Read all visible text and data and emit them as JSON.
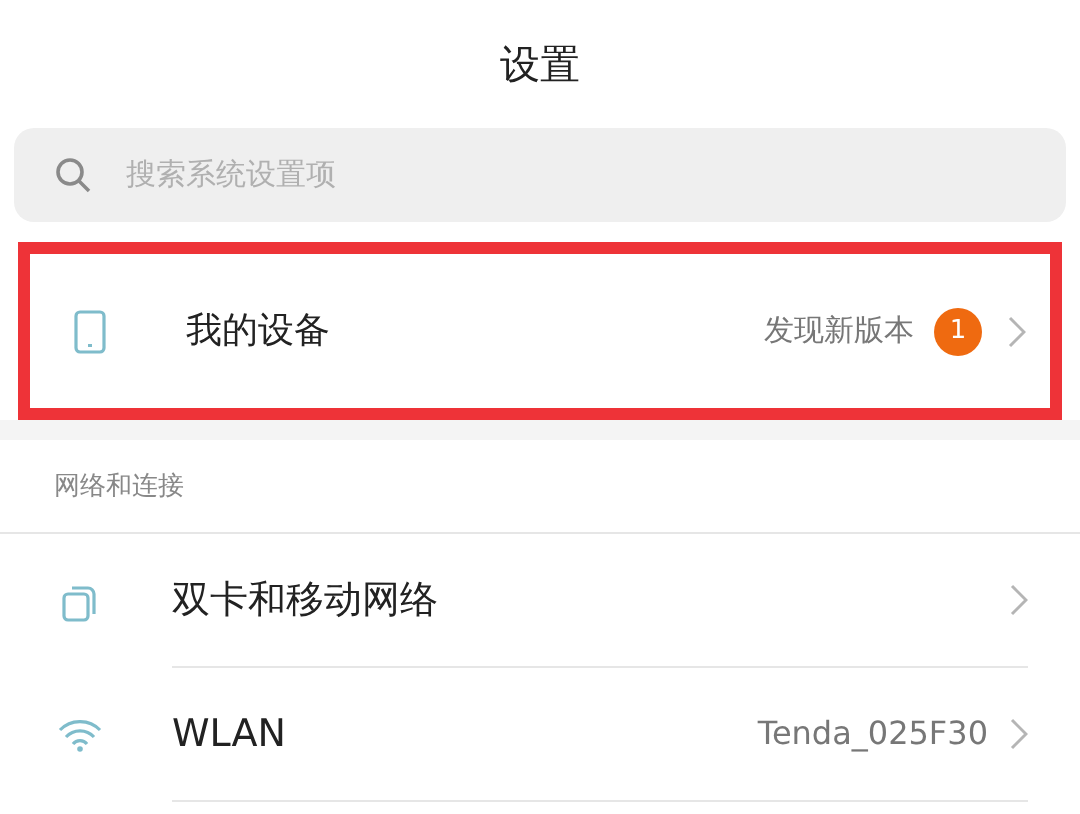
{
  "title": "设置",
  "search": {
    "placeholder": "搜索系统设置项"
  },
  "device_row": {
    "label": "我的设备",
    "value": "发现新版本",
    "badge": "1",
    "highlighted": true
  },
  "section": {
    "header": "网络和连接",
    "items": [
      {
        "kind": "sim",
        "label": "双卡和移动网络"
      },
      {
        "kind": "wifi",
        "label": "WLAN",
        "value": "Tenda_025F30"
      }
    ]
  }
}
